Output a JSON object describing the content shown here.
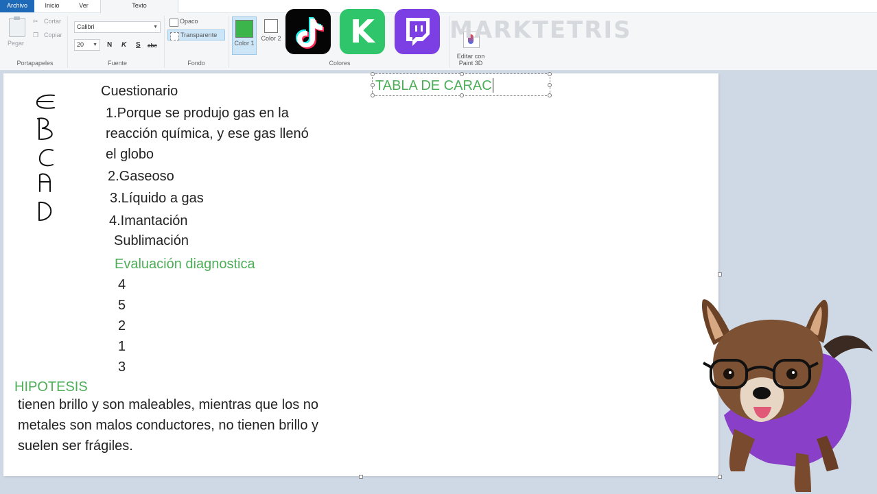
{
  "tabs": {
    "file": "Archivo",
    "home": "Inicio",
    "view": "Ver",
    "text": "Texto"
  },
  "ribbon": {
    "clipboard": {
      "paste": "Pegar",
      "cut": "Cortar",
      "copy": "Copiar",
      "group": "Portapapeles"
    },
    "font": {
      "family": "Calibri",
      "size": "20",
      "bold": "N",
      "italic": "K",
      "underline": "S",
      "strike": "abc",
      "group": "Fuente"
    },
    "background": {
      "opaque": "Opaco",
      "transparent": "Transparente",
      "group": "Fondo"
    },
    "colors": {
      "color1": "Color 1",
      "color2": "Color 2",
      "group": "Colores",
      "color1_value": "#3cb54a",
      "color2_value": "#ffffff"
    },
    "edit3d": "Editar con Paint 3D",
    "watermark": "MARKTETRIS"
  },
  "canvas": {
    "textbox": "TABLA DE CARAC",
    "questionnaire_title": "Cuestionario",
    "answers": [
      "1.Porque se produjo gas en la",
      "reacción química, y ese gas llenó",
      "el globo",
      "2.Gaseoso",
      "3.Líquido a gas",
      "4.Imantación",
      "Sublimación"
    ],
    "diagnostic_title": "Evaluación diagnostica",
    "diagnostic_numbers": [
      "4",
      "5",
      "2",
      "1",
      "3"
    ],
    "hypothesis_title": "HIPOTESIS",
    "hypothesis_lines": [
      "tienen brillo y son maleables, mientras que los no",
      "metales son malos conductores, no tienen brillo y",
      "suelen ser frágiles."
    ]
  },
  "colors": {
    "accent_green": "#4cae57",
    "file_tab": "#1e6ab8"
  }
}
